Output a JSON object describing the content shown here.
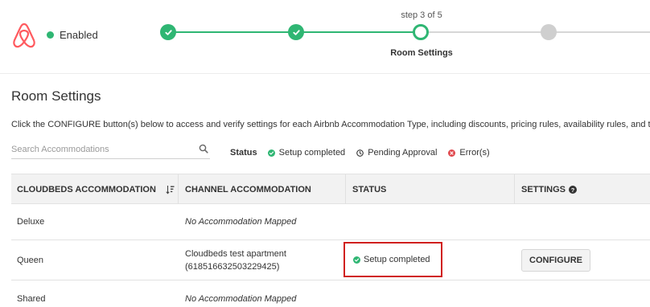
{
  "header": {
    "logo_icon": "airbnb-logo-icon",
    "enabled_label": "Enabled",
    "enabled_color": "#2fb673"
  },
  "stepper": {
    "caption": "step 3 of 5",
    "current_title": "Room Settings",
    "current_step": 3,
    "total_steps": 5,
    "accent_color": "#2fb673"
  },
  "page": {
    "title": "Room Settings",
    "description": "Click the CONFIGURE button(s) below to access and verify settings for each Airbnb Accommodation Type, including discounts, pricing rules, availability rules, and ta"
  },
  "search": {
    "placeholder": "Search Accommodations",
    "value": "",
    "icon": "search-icon"
  },
  "legend": {
    "label": "Status",
    "items": [
      {
        "label": "Setup completed",
        "icon": "check-circle-icon",
        "color": "#2fb673"
      },
      {
        "label": "Pending Approval",
        "icon": "clock-icon",
        "color": "#333333"
      },
      {
        "label": "Error(s)",
        "icon": "error-circle-icon",
        "color": "#e0474c"
      }
    ]
  },
  "table": {
    "headers": [
      "CLOUDBEDS ACCOMMODATION",
      "CHANNEL ACCOMMODATION",
      "STATUS",
      "SETTINGS"
    ],
    "rows": [
      {
        "cloudbeds": "Deluxe",
        "channel": "No Accommodation Mapped",
        "status": "",
        "settings": ""
      },
      {
        "cloudbeds": "Queen",
        "channel_line1": "Cloudbeds test apartment",
        "channel_line2": "(618516632503229425)",
        "status": "Setup completed",
        "settings": "CONFIGURE"
      },
      {
        "cloudbeds": "Shared",
        "channel": "No Accommodation Mapped",
        "status": "",
        "settings": ""
      }
    ]
  }
}
